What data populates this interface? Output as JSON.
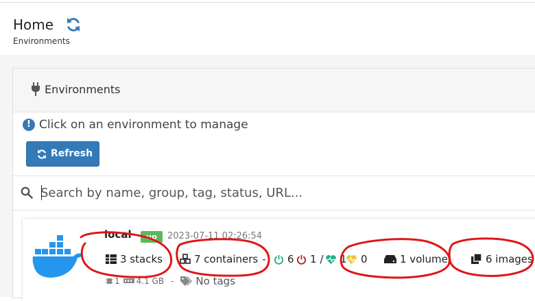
{
  "header": {
    "title": "Home",
    "breadcrumb": "Environments"
  },
  "widget": {
    "title": "Environments",
    "info_text": "Click on an environment to manage",
    "refresh_label": "Refresh",
    "search": {
      "placeholder": "Search by name, group, tag, status, URL...",
      "value": ""
    }
  },
  "environment": {
    "name": "local",
    "status": "up",
    "timestamp": "2023-07-11 02:26:54",
    "stacks": "3 stacks",
    "containers": "7 containers",
    "separator": "-",
    "running": "6",
    "stopped": "1",
    "slash": "/",
    "healthy": "1",
    "unhealthy": "0",
    "volumes": "1 volume",
    "images": "6 images",
    "cpu": "1",
    "memory": "4.1 GB",
    "tags_separator": "-",
    "tags": "No tags"
  },
  "colors": {
    "primary": "#337ab7",
    "success": "#5cb85c",
    "running": "#23ae89",
    "stopped": "#ae2323",
    "healthy": "#23ae89",
    "unhealthy": "#e9c63b",
    "docker": "#2496ed",
    "annotation": "#e01515"
  }
}
